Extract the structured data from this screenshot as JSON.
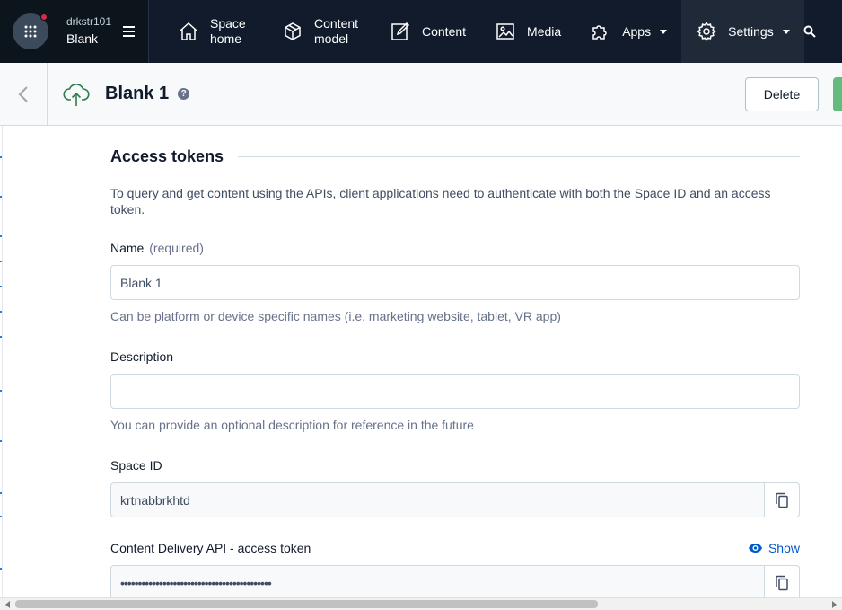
{
  "topnav": {
    "org_name": "drkstr101",
    "space_name": "Blank",
    "items": [
      {
        "label": "Space home",
        "icon": "home-icon"
      },
      {
        "label": "Content model",
        "icon": "content-model-icon"
      },
      {
        "label": "Content",
        "icon": "content-edit-icon"
      },
      {
        "label": "Media",
        "icon": "media-icon"
      },
      {
        "label": "Apps",
        "icon": "puzzle-icon"
      },
      {
        "label": "Settings",
        "icon": "gear-icon"
      }
    ]
  },
  "header": {
    "title": "Blank 1",
    "help": "?",
    "delete_label": "Delete"
  },
  "access_tokens": {
    "heading": "Access tokens",
    "intro": "To query and get content using the APIs, client applications need to authenticate with both the Space ID and an access token.",
    "name_label": "Name",
    "name_required": "(required)",
    "name_value": "Blank 1",
    "name_help": "Can be platform or device specific names (i.e. marketing website, tablet, VR app)",
    "description_label": "Description",
    "description_value": "",
    "description_help": "You can provide an optional description for reference in the future",
    "space_id_label": "Space ID",
    "space_id_value": "krtnabbrkhtd",
    "cda_label": "Content Delivery API - access token",
    "cda_show": "Show",
    "cda_value": "•••••••••••••••••••••••••••••••••••••••••••"
  },
  "colors": {
    "nav_bg": "#111b2b",
    "accent_link": "#0059c8",
    "notification_dot": "#da294a",
    "save_green": "#65ba7e"
  }
}
